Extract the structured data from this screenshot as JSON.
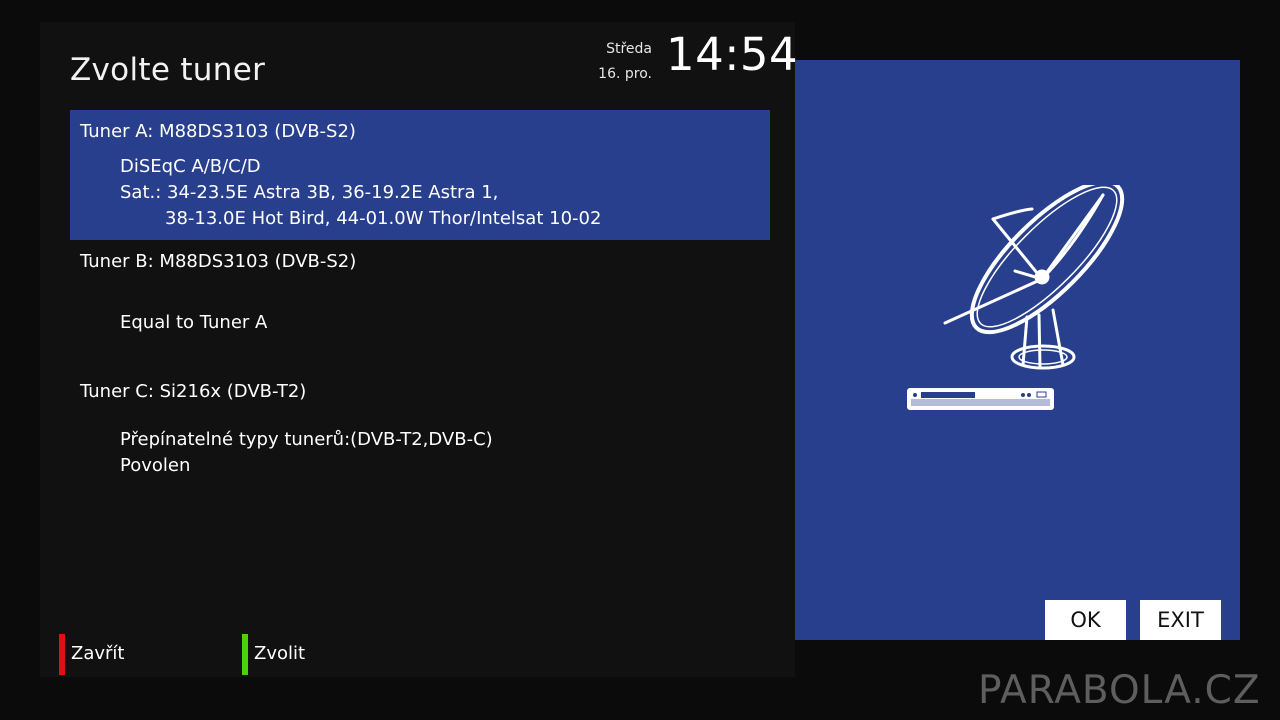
{
  "page_title": "Zvolte tuner",
  "clock": {
    "weekday": "Středa",
    "date": "16. pro.",
    "time": "14:54"
  },
  "tuners": [
    {
      "name": "Tuner A: M88DS3103 (DVB-S2)",
      "selected": true,
      "lines": [
        "DiSEqC A/B/C/D",
        "Sat.: 34-23.5E Astra 3B, 36-19.2E Astra 1,",
        "38-13.0E Hot Bird, 44-01.0W Thor/Intelsat 10-02"
      ]
    },
    {
      "name": "Tuner B: M88DS3103 (DVB-S2)",
      "selected": false,
      "lines": [
        "Equal to Tuner A"
      ]
    },
    {
      "name": "Tuner C: Si216x (DVB-T2)",
      "selected": false,
      "lines": [
        "Přepínatelné typy tunerů:(DVB-T2,DVB-C)",
        "Povolen"
      ]
    }
  ],
  "preview": {
    "icon": "satellite-dish-receiver-icon",
    "ok_label": "OK",
    "exit_label": "EXIT"
  },
  "legend": {
    "red_label": "Zavřít",
    "green_label": "Zvolit",
    "red_color": "#e01010",
    "green_color": "#4cd10a"
  },
  "colors": {
    "highlight": "#273f8c",
    "panel": "#111111",
    "background": "#0b0b0b"
  },
  "watermark": "PARABOLA.CZ"
}
